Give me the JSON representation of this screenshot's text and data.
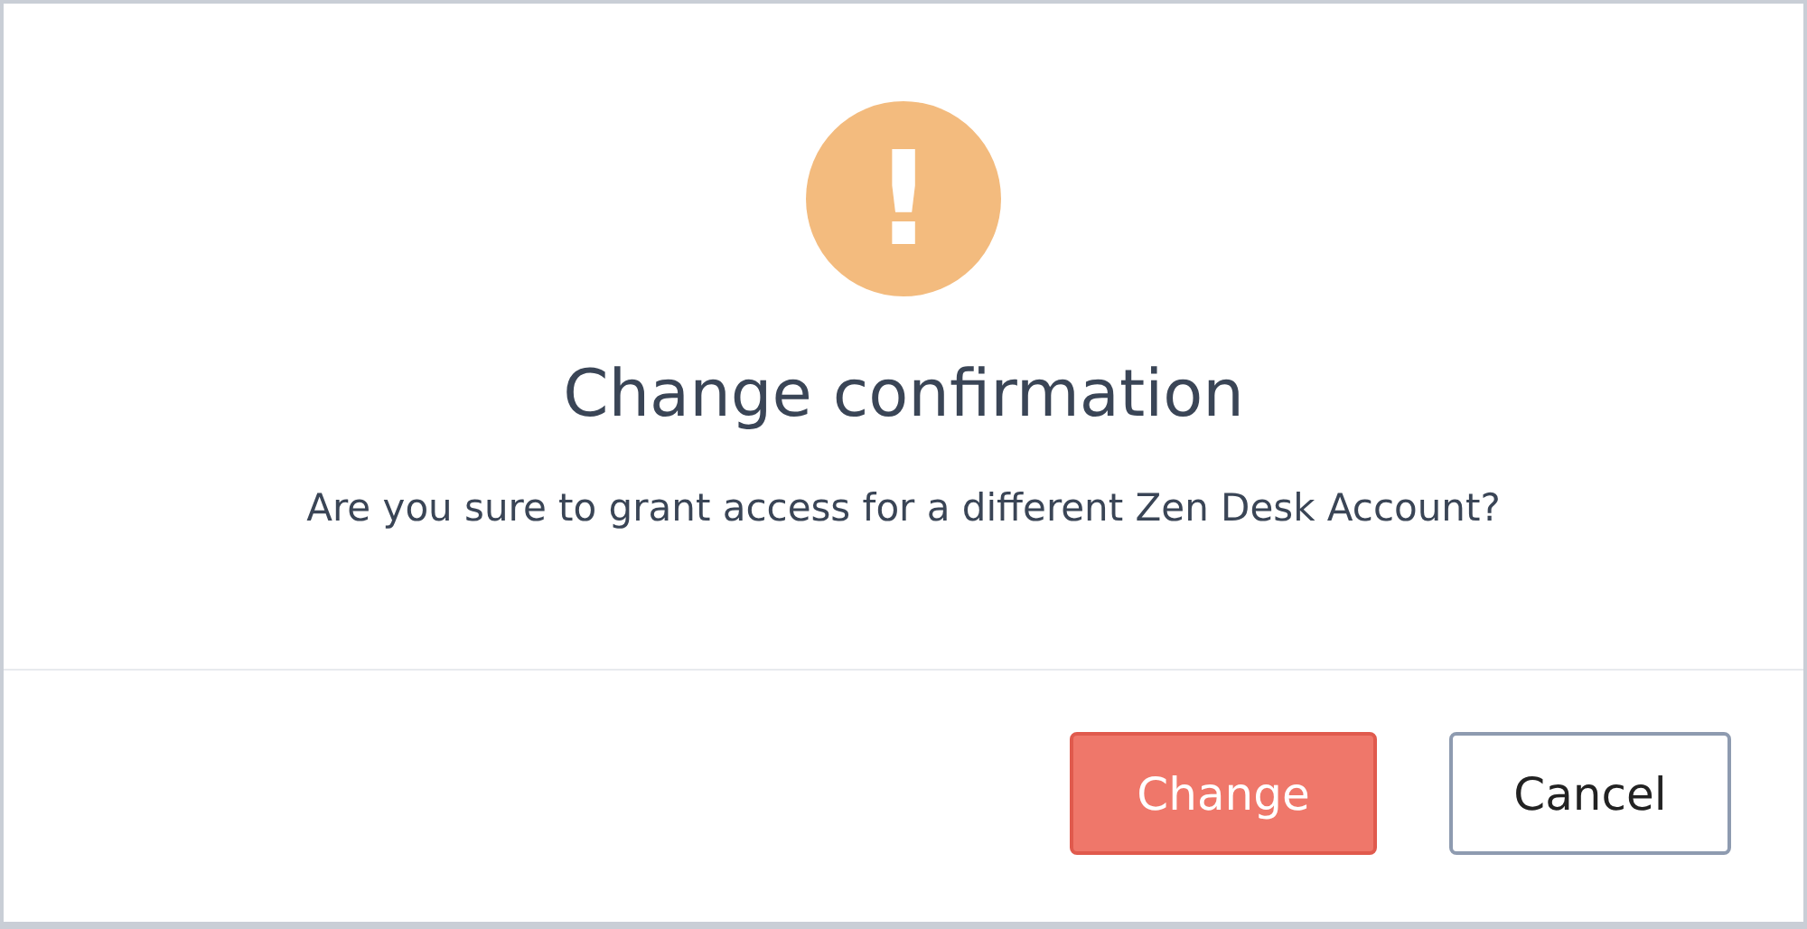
{
  "dialog": {
    "icon": "!",
    "title": "Change confirmation",
    "message": "Are you sure to grant access for a different Zen Desk Account?",
    "buttons": [
      {
        "label": "Change",
        "kind": "primary"
      },
      {
        "label": "Cancel",
        "kind": "secondary"
      }
    ]
  }
}
